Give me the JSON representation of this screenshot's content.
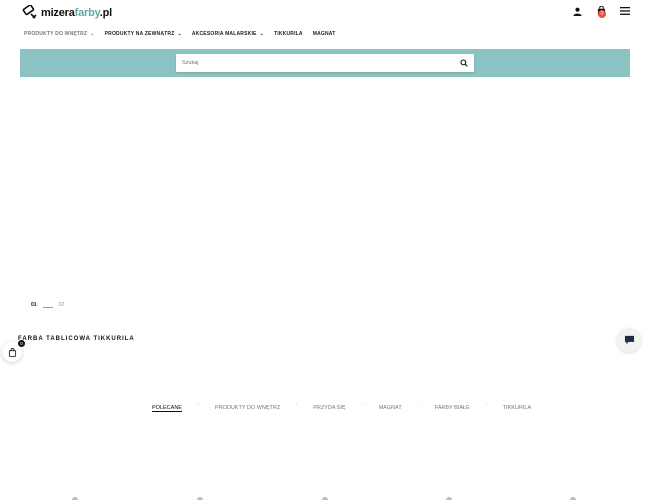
{
  "header": {
    "logo": {
      "part1": "mizera",
      "part2": "farby",
      "part3": ".pl"
    },
    "cart_count": "0"
  },
  "nav": {
    "items": [
      {
        "label": "PRODUKTY DO WNĘTRZ",
        "has_dropdown": true,
        "active": true
      },
      {
        "label": "PRODUKTY NA ZEWNĄTRZ",
        "has_dropdown": true
      },
      {
        "label": "AKCESORIA MALARSKIE",
        "has_dropdown": true
      },
      {
        "label": "TIKKURILA",
        "has_dropdown": false
      },
      {
        "label": "MAGNAT",
        "has_dropdown": false
      }
    ]
  },
  "search": {
    "placeholder": "Szukaj"
  },
  "slider": {
    "current": "01",
    "next": "02"
  },
  "product_title": "FARBA TABLICOWA TIKKURILA",
  "floating_cart": {
    "count": "0"
  },
  "tabs": [
    {
      "label": "POLECANE",
      "active": true
    },
    {
      "label": "PRODUKTY DO WNĘTRZ"
    },
    {
      "label": "PRZYDA SIĘ"
    },
    {
      "label": "MAGNAT"
    },
    {
      "label": "FARBY BIAŁE"
    },
    {
      "label": "TIKKURILA"
    }
  ],
  "colors": {
    "accent": "#8cc3c2",
    "badge": "#e8503a",
    "logo_accent": "#5aa9a8"
  }
}
